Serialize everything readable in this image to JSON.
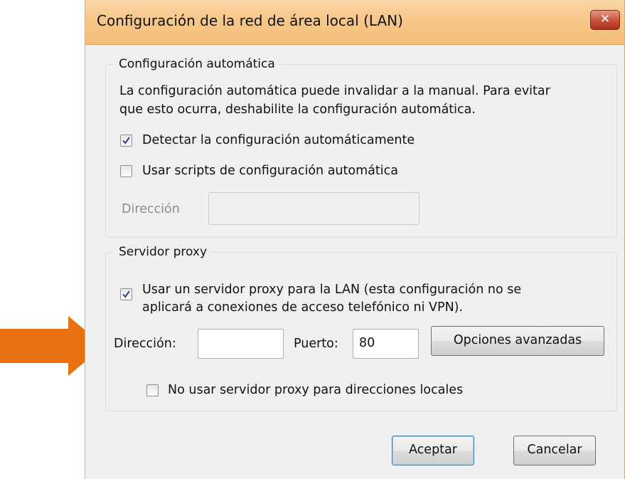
{
  "window": {
    "title": "Configuración de la red de área local (LAN)",
    "close_glyph": "✕",
    "accent_color": "#f4bc78"
  },
  "auto_config": {
    "legend": "Configuración automática",
    "description_line1": "La configuración automática puede invalidar a la manual. Para evitar",
    "description_line2": "que esto ocurra, deshabilite la configuración automática.",
    "detect_label": "Detectar la configuración automáticamente",
    "detect_checked": true,
    "scripts_label": "Usar scripts de configuración automática",
    "scripts_checked": false,
    "address_label": "Dirección",
    "address_value": ""
  },
  "proxy": {
    "legend": "Servidor proxy",
    "use_proxy_line1": "Usar un servidor proxy para la LAN (esta configuración no se",
    "use_proxy_line2": "aplicará a conexiones de acceso telefónico ni VPN).",
    "use_proxy_checked": true,
    "address_label": "Dirección:",
    "address_value": "",
    "port_label": "Puerto:",
    "port_value": "80",
    "advanced_button": "Opciones avanzadas",
    "bypass_local_label": "No usar servidor proxy para direcciones locales",
    "bypass_local_checked": false
  },
  "buttons": {
    "ok": "Aceptar",
    "cancel": "Cancelar"
  },
  "annotation": {
    "arrow_icon": "right-arrow-icon",
    "arrow_color": "#e8710f"
  }
}
